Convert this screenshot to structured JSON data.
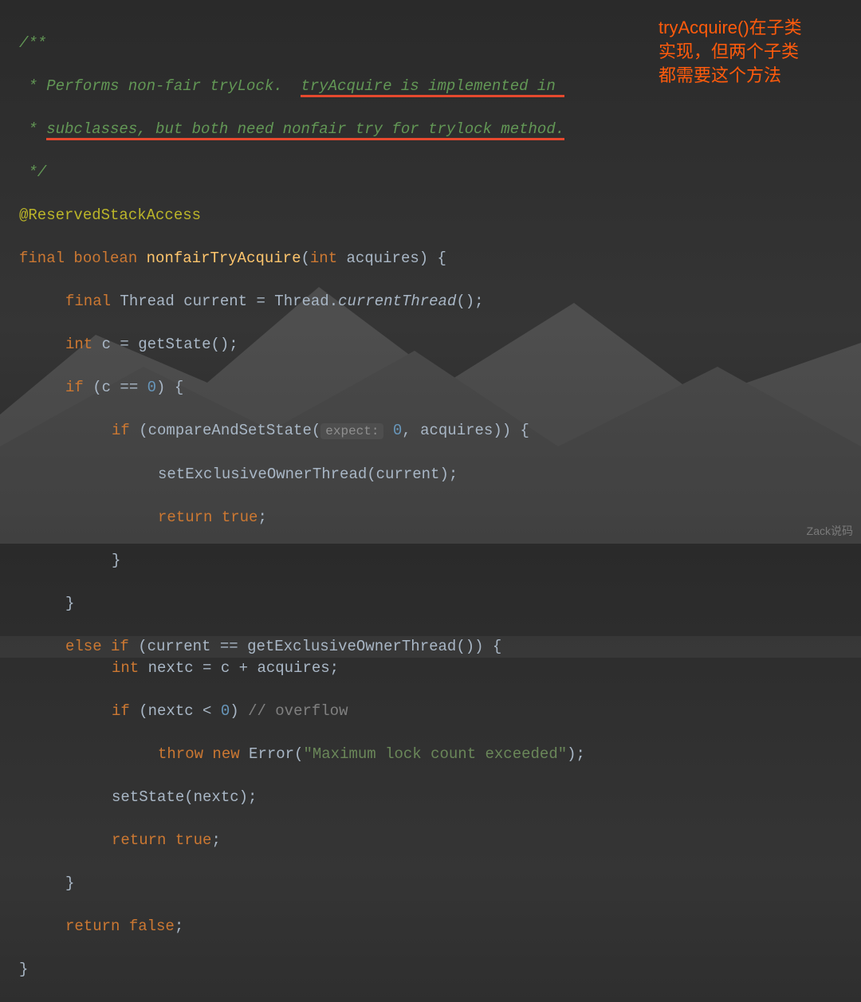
{
  "comment": {
    "l1": "/**",
    "l2_a": " * Performs non-fair tryLock.  ",
    "l2_b": "tryAcquire is implemented in ",
    "l3_a": " * ",
    "l3_b": "subclasses, but both need nonfair try for trylock method.",
    "l4": " */"
  },
  "code": {
    "annotation": "@ReservedStackAccess",
    "kw_final": "final",
    "kw_boolean": "boolean",
    "method_name": "nonfairTryAcquire",
    "kw_int": "int",
    "param": "acquires",
    "kw_final2": "final",
    "type_thread": "Thread",
    "var_current": "current",
    "eq": " = ",
    "thread_cls": "Thread",
    "dot": ".",
    "currentThread": "currentThread",
    "oc": "();",
    "kw_int2": "int",
    "var_c": "c",
    "getState": "getState",
    "if1": "if",
    "cond1": " (c == ",
    "zero": "0",
    "cond1b": ") {",
    "if2": "if",
    "cond2a": " (compareAndSetState(",
    "hint_expect": "expect:",
    "zero2": " 0",
    "cond2b": ", acquires)) {",
    "setOwner": "setExclusiveOwnerThread(current);",
    "return_true": "return",
    "true": "true",
    "semi": ";",
    "rbrace": "}",
    "else_if": "else if",
    "cond3a": " (current == ",
    "getOwner": "getExclusiveOwnerThread",
    "cond3b": "()) {",
    "kw_int3": "int",
    "nextc_decl": " nextc = c + acquires;",
    "if3": "if",
    "cond4a": " (nextc < ",
    "zero3": "0",
    "cond4b": ") ",
    "overflow_cmt": "// overflow",
    "throw": "throw",
    "new": "new",
    "error": " Error(",
    "errmsg": "\"Maximum lock count exceeded\"",
    "cparen": ");",
    "setState": "setState(nextc);",
    "return_false": "return",
    "false": "false"
  },
  "annotation_cn": {
    "l1": "tryAcquire()在子类",
    "l2": "实现，但两个子类",
    "l3": "都需要这个方法"
  },
  "watermark": "Zack说码"
}
